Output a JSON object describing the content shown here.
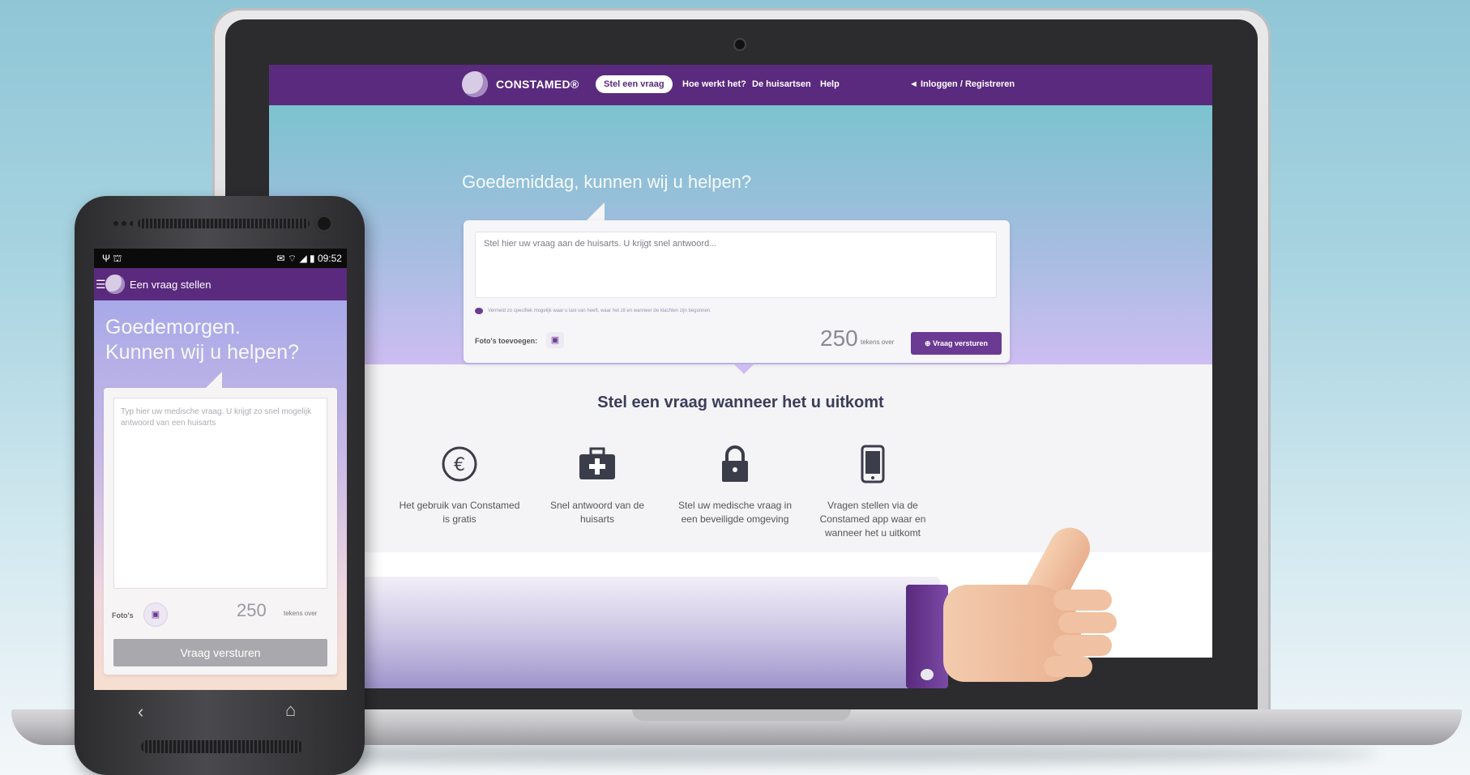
{
  "desktop": {
    "brand": "CONSTAMED®",
    "nav": {
      "active_pill": "Stel een vraag",
      "links": [
        "Hoe werkt het?",
        "De huisartsen",
        "Help"
      ],
      "login": "◄ Inloggen / Registreren"
    },
    "greeting": "Goedemiddag, kunnen wij u helpen?",
    "question_placeholder": "Stel hier uw vraag aan de huisarts. U krijgt snel antwoord...",
    "hint_text": "Vermeld zo specifiek mogelijk waar u last van heeft, waar het zit en wanneer de klachten zijn begonnen",
    "photos_label": "Foto's toevoegen:",
    "char_count": "250",
    "char_label": "tekens over",
    "send_button": "⊕ Vraag versturen",
    "section_title": "Stel een vraag wanneer het u uitkomt",
    "features": [
      {
        "icon": "euro-icon",
        "glyph": "€",
        "text": "Het gebruik van Constamed is gratis"
      },
      {
        "icon": "first-aid-kit-icon",
        "glyph": "✚",
        "text": "Snel antwoord van de huisarts"
      },
      {
        "icon": "lock-icon",
        "glyph": "🔒",
        "text": "Stel uw medische vraag in een beveiligde omgeving"
      },
      {
        "icon": "smartphone-icon",
        "glyph": "▯",
        "text": "Vragen stellen via de Constamed app waar en wanneer het u uitkomt"
      }
    ]
  },
  "mobile": {
    "status_left": "Ψ ⛫",
    "status_right": "✉ ⌔ ◢ ▮ 09:52",
    "app_title": "Een vraag stellen",
    "greeting_line1": "Goedemorgen.",
    "greeting_line2": "Kunnen wij u helpen?",
    "textarea_placeholder": "Typ hier uw medische vraag. U krijgt zo snel mogelijk antwoord van een huisarts",
    "photos_label": "Foto's",
    "char_count": "250",
    "char_label": "tekens over",
    "send_button": "Vraag versturen"
  },
  "colors": {
    "brand_purple": "#5a2a7e",
    "accent_purple": "#6b3a92"
  }
}
